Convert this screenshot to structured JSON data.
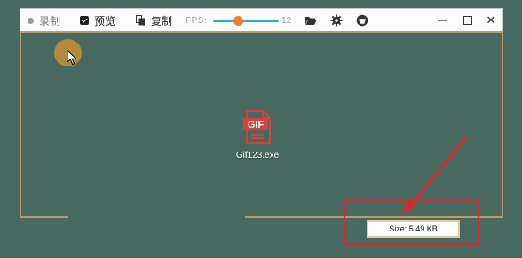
{
  "toolbar": {
    "record_label": "录制",
    "preview_label": "预览",
    "preview_checked": true,
    "copy_label": "复制",
    "fps_label": "FPS:",
    "fps_value": "12",
    "fps_slider_fraction": 0.38,
    "icons": [
      "folder-open-icon",
      "gear-icon",
      "github-icon"
    ],
    "window_controls": [
      "minimize",
      "maximize",
      "close"
    ],
    "minimize_glyph": "—",
    "close_glyph": "✕"
  },
  "desktop": {
    "icon_text": "GIF",
    "icon_label": "Gif123.exe",
    "icon_color": "#d9403b"
  },
  "status": {
    "size_text": "Size: 5.49 KB"
  },
  "colors": {
    "background": "#486960",
    "frame": "#b79a70",
    "annotation": "#d8272b",
    "slider_track": "#2fa9e0",
    "slider_knob": "#f07e2c"
  }
}
